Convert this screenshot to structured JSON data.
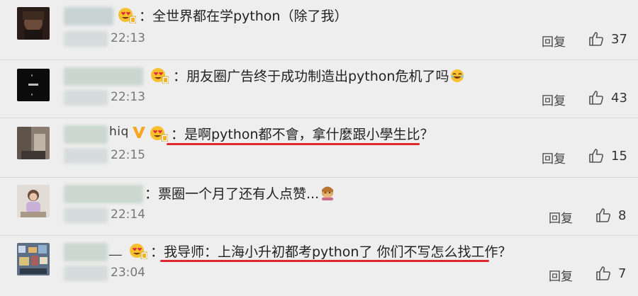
{
  "comments": [
    {
      "name_suffix": "",
      "text": "：全世界都在学python（除了我）",
      "time": "22:13",
      "reply_label": "回复",
      "likes": "37"
    },
    {
      "name_suffix": "",
      "text": "：朋友圈广告终于成功制造出python危机了吗",
      "time": "22:13",
      "reply_label": "回复",
      "likes": "43"
    },
    {
      "name_suffix": "hiq",
      "text": "：是啊python都不會，拿什麼跟小學生比？",
      "time": "22:15",
      "reply_label": "回复",
      "likes": "15"
    },
    {
      "name_suffix": "",
      "text": "：票圈一个月了还有人点赞...",
      "time": "22:14",
      "reply_label": "回复",
      "likes": "8"
    },
    {
      "name_suffix": "__",
      "text": "：我导师：上海小升初都考python了 你们不写怎么找工作？",
      "time": "23:04",
      "reply_label": "回复",
      "likes": "7"
    }
  ],
  "colors": {
    "underline": "#e0262d",
    "background": "#eeeeee",
    "vip_badge": "#f5a623"
  },
  "icons": [
    "heart-eyes-badge-icon",
    "vip-v-icon",
    "thumbs-up-icon",
    "laughing-emoji-icon",
    "covering-mouth-emoji-icon"
  ]
}
